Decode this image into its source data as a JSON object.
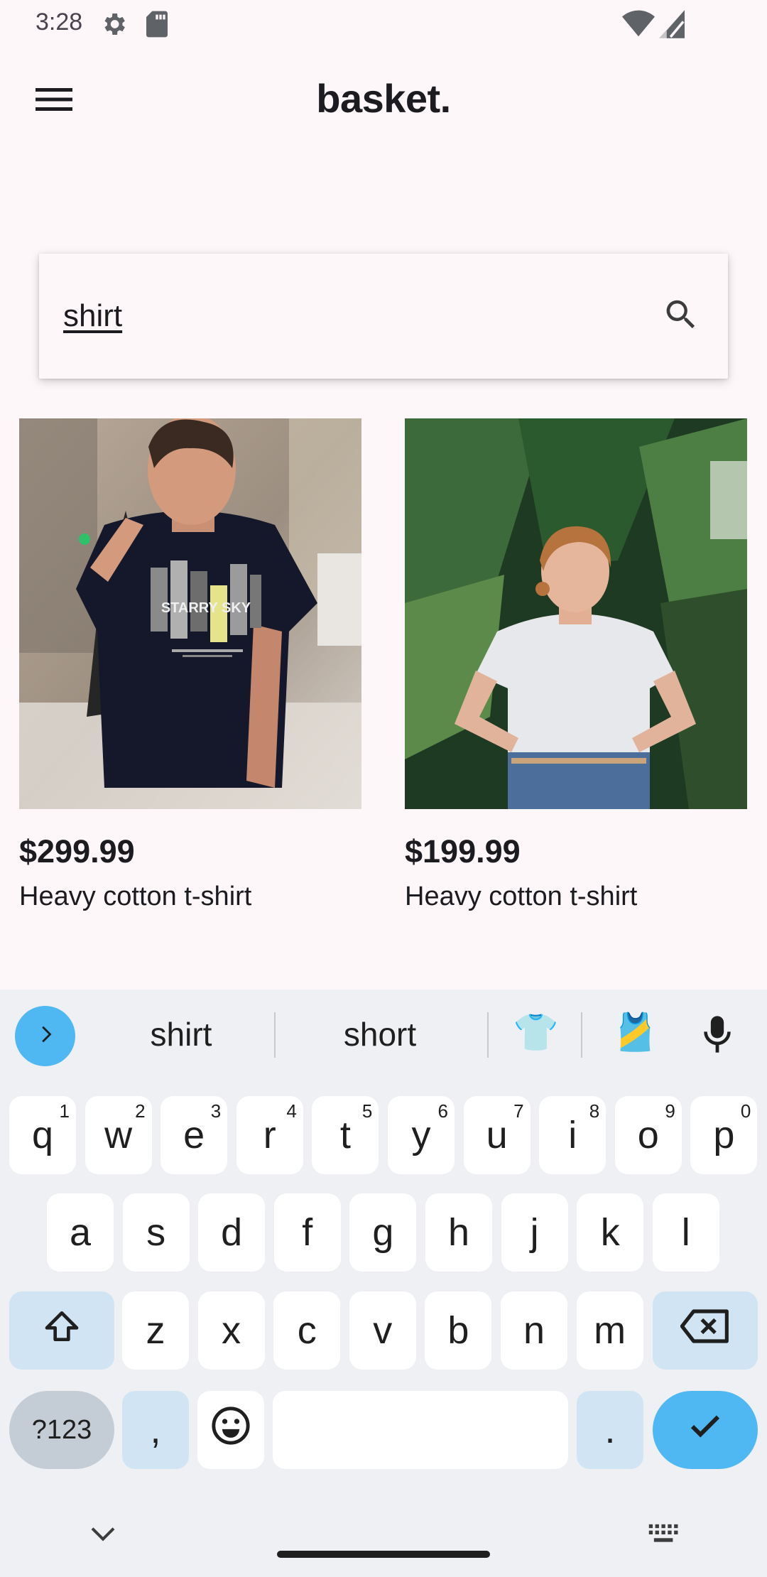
{
  "status_bar": {
    "time": "3:28",
    "icons": [
      "settings-gear-icon",
      "sd-card-icon",
      "wifi-icon",
      "cell-signal-icon"
    ]
  },
  "app_bar": {
    "title": "basket.",
    "menu_icon": "hamburger-menu-icon"
  },
  "search": {
    "value": "shirt",
    "placeholder": "",
    "icon": "search-icon"
  },
  "products": [
    {
      "price": "$299.99",
      "name": "Heavy cotton t-shirt",
      "image": "man in black graphic t-shirt",
      "image_text": "STARRY SKY"
    },
    {
      "price": "$199.99",
      "name": "Heavy cotton t-shirt",
      "image": "woman in white t-shirt among banana leaves"
    }
  ],
  "keyboard": {
    "suggestions": [
      "shirt",
      "short"
    ],
    "emoji_suggestions": [
      "👕",
      "🎽"
    ],
    "rows": [
      [
        {
          "k": "q",
          "n": "1"
        },
        {
          "k": "w",
          "n": "2"
        },
        {
          "k": "e",
          "n": "3"
        },
        {
          "k": "r",
          "n": "4"
        },
        {
          "k": "t",
          "n": "5"
        },
        {
          "k": "y",
          "n": "6"
        },
        {
          "k": "u",
          "n": "7"
        },
        {
          "k": "i",
          "n": "8"
        },
        {
          "k": "o",
          "n": "9"
        },
        {
          "k": "p",
          "n": "0"
        }
      ],
      [
        "a",
        "s",
        "d",
        "f",
        "g",
        "h",
        "j",
        "k",
        "l"
      ],
      [
        "z",
        "x",
        "c",
        "v",
        "b",
        "n",
        "m"
      ]
    ],
    "symbols_label": "?123",
    "comma": ",",
    "period": ".",
    "icons": {
      "expand": "chevron-right-icon",
      "mic": "microphone-icon",
      "shift": "shift-icon",
      "backspace": "backspace-icon",
      "emoji": "emoji-icon",
      "enter": "checkmark-icon",
      "hide": "chevron-down-icon",
      "switch_keyboard": "keyboard-icon"
    },
    "colors": {
      "accent": "#4fb8f2",
      "modifier": "#d1e4f4",
      "background": "#eff0f3"
    }
  }
}
